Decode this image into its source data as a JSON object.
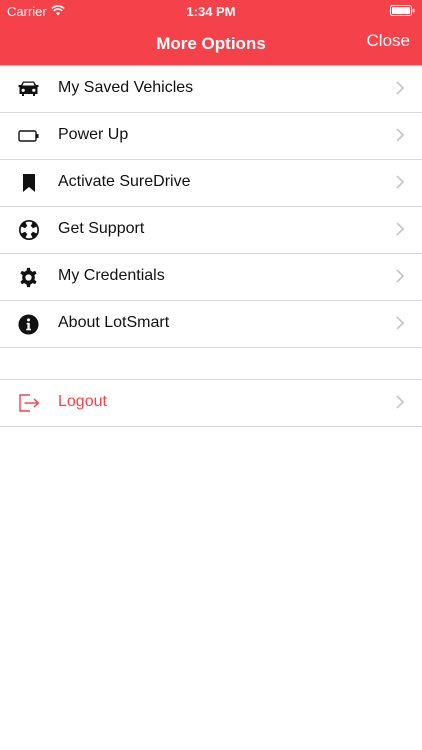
{
  "status_bar": {
    "carrier": "Carrier",
    "time": "1:34 PM",
    "wifi_icon": "wifi-icon",
    "battery_icon": "battery-full-icon"
  },
  "header": {
    "title": "More Options",
    "close_label": "Close",
    "background_color": "#f5424a"
  },
  "menu": {
    "items": [
      {
        "label": "My Saved Vehicles",
        "icon": "car-icon"
      },
      {
        "label": "Power Up",
        "icon": "battery-outline-icon"
      },
      {
        "label": "Activate SureDrive",
        "icon": "bookmark-icon"
      },
      {
        "label": "Get Support",
        "icon": "lifebuoy-icon"
      },
      {
        "label": "My Credentials",
        "icon": "gear-icon"
      },
      {
        "label": "About LotSmart",
        "icon": "info-icon"
      }
    ],
    "logout": {
      "label": "Logout",
      "icon": "logout-icon",
      "color": "#f0444b"
    }
  }
}
